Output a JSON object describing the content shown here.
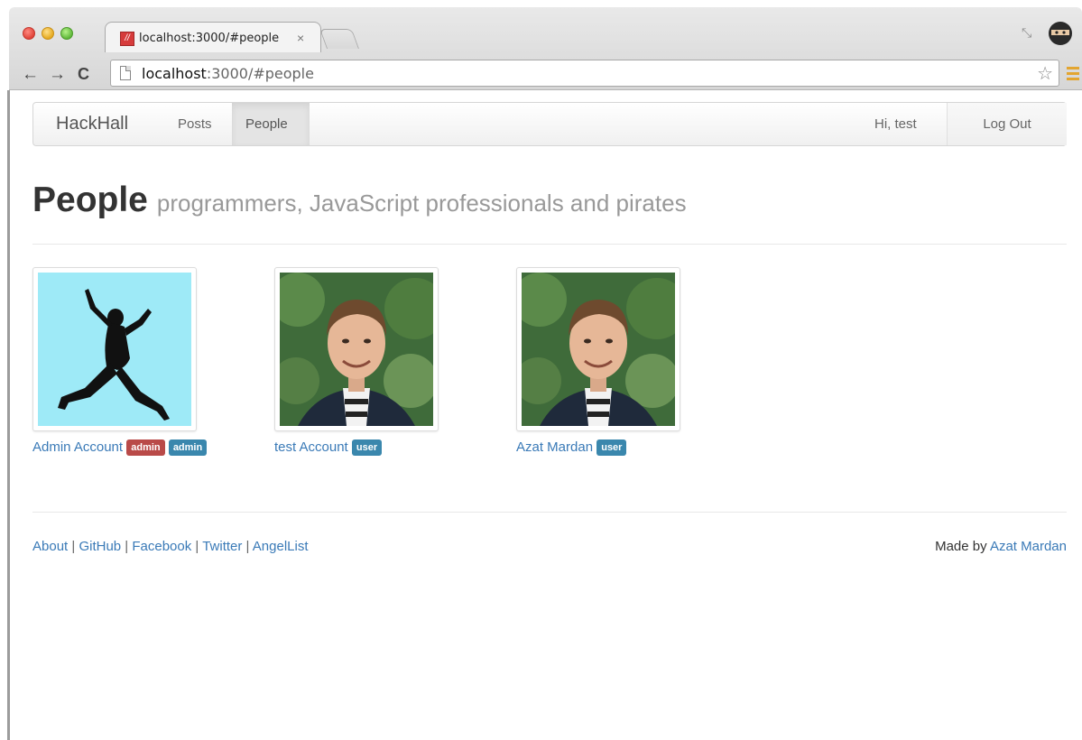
{
  "browser": {
    "tab_title": "localhost:3000/#people",
    "tab_close": "×",
    "url_host": "localhost",
    "url_rest": ":3000/#people"
  },
  "navbar": {
    "brand": "HackHall",
    "links": [
      "Posts",
      "People"
    ],
    "active": "People",
    "greeting": "Hi, test",
    "logout": "Log Out"
  },
  "header": {
    "title": "People",
    "subtitle": "programmers, JavaScript professionals and pirates"
  },
  "people": [
    {
      "name": "Admin Account",
      "badges": [
        {
          "label": "admin",
          "color": "#b94a48"
        },
        {
          "label": "admin",
          "color": "#3a87ad"
        }
      ],
      "photo": "jumping-silhouette"
    },
    {
      "name": "test Account",
      "badges": [
        {
          "label": "user",
          "color": "#3a87ad"
        }
      ],
      "photo": "portrait"
    },
    {
      "name": "Azat Mardan",
      "badges": [
        {
          "label": "user",
          "color": "#3a87ad"
        }
      ],
      "photo": "portrait"
    }
  ],
  "footer": {
    "links": [
      "About",
      "GitHub",
      "Facebook",
      "Twitter",
      "AngelList"
    ],
    "separator": " | ",
    "made_by_prefix": "Made by ",
    "made_by_name": "Azat Mardan"
  },
  "colors": {
    "link": "#3a7ab7",
    "badge_admin": "#b94a48",
    "badge_blue": "#3a87ad"
  }
}
